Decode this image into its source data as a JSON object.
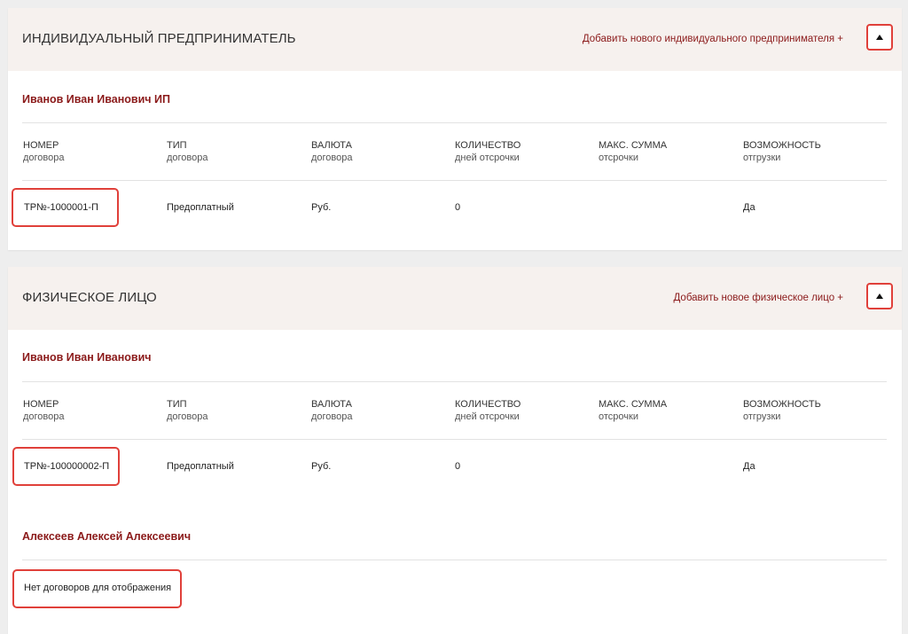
{
  "sections": [
    {
      "title": "ИНДИВИДУАЛЬНЫЙ ПРЕДПРИНИМАТЕЛЬ",
      "add_link": "Добавить нового индивидуального предпринимателя +",
      "entries": [
        {
          "name": "Иванов Иван Иванович ИП",
          "row": {
            "number": "ТР№-1000001-П",
            "type": "Предоплатный",
            "currency": "Руб.",
            "days": "0",
            "max_sum": "",
            "shipment": "Да"
          }
        }
      ]
    },
    {
      "title": "ФИЗИЧЕСКОЕ ЛИЦО",
      "add_link": "Добавить новое физическое лицо +",
      "entries": [
        {
          "name": "Иванов Иван Иванович",
          "row": {
            "number": "ТР№-100000002-П",
            "type": "Предоплатный",
            "currency": "Руб.",
            "days": "0",
            "max_sum": "",
            "shipment": "Да"
          }
        },
        {
          "name": "Алексеев Алексей Алексеевич",
          "empty_message": "Нет договоров для отображения"
        }
      ]
    }
  ],
  "columns": [
    {
      "line1": "НОМЕР",
      "line2": "договора"
    },
    {
      "line1": "ТИП",
      "line2": "договора"
    },
    {
      "line1": "ВАЛЮТА",
      "line2": "договора"
    },
    {
      "line1": "КОЛИЧЕСТВО",
      "line2": "дней отсрочки"
    },
    {
      "line1": "МАКС. СУММА",
      "line2": "отсрочки"
    },
    {
      "line1": "ВОЗМОЖНОСТЬ",
      "line2": "отгрузки"
    }
  ],
  "icons": {
    "toggle": "triangle-up-icon"
  },
  "colors": {
    "accent": "#8b1a1a",
    "highlight": "#e0403a",
    "header_bg": "#f6f1ee"
  }
}
